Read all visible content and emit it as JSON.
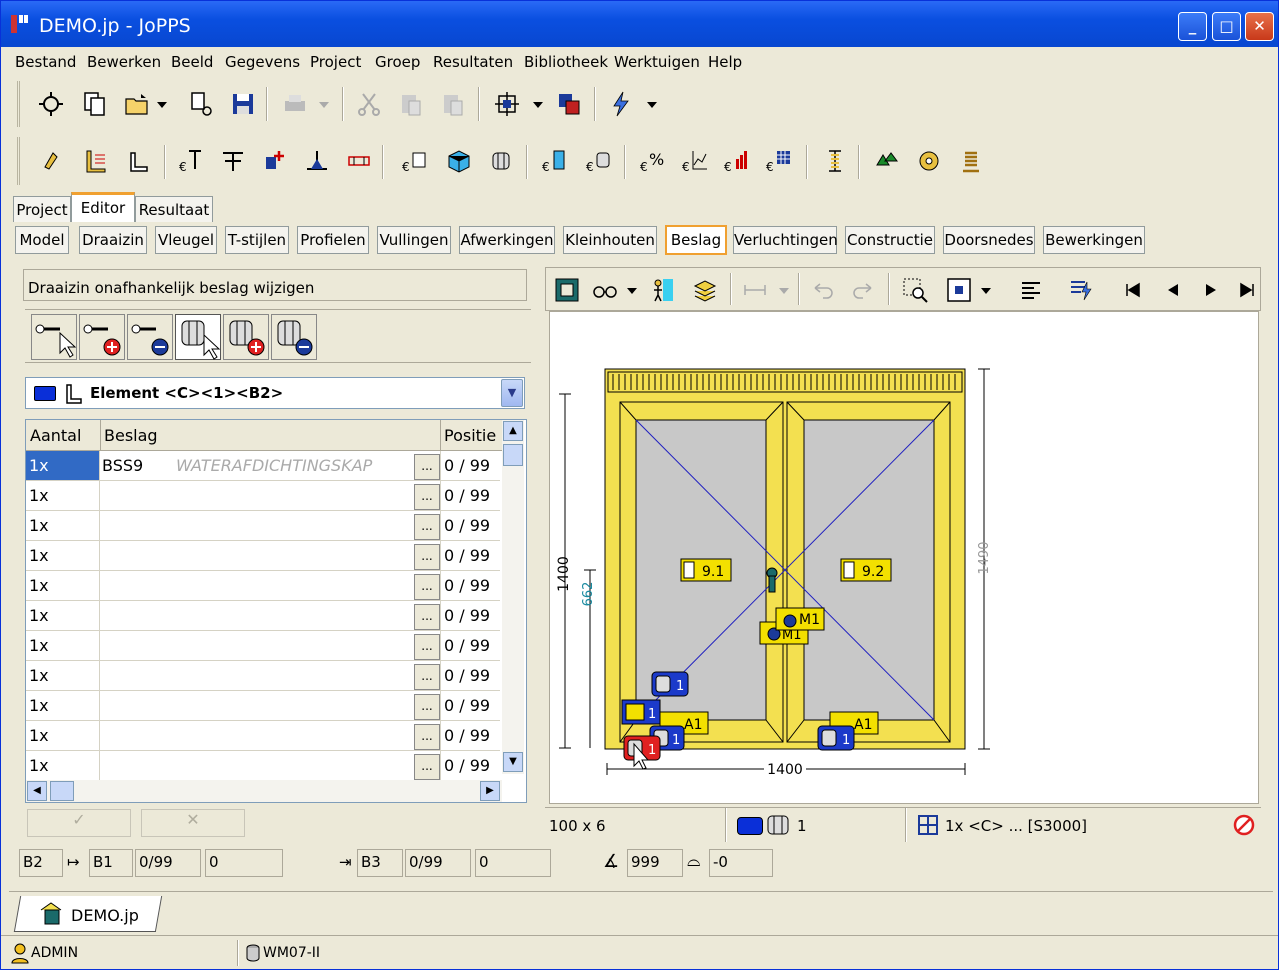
{
  "window": {
    "title": "DEMO.jp - JoPPS"
  },
  "menu": [
    "Bestand",
    "Bewerken",
    "Beeld",
    "Gegevens",
    "Project",
    "Groep",
    "Resultaten",
    "Bibliotheek",
    "Werktuigen",
    "Help"
  ],
  "main_tabs": [
    "Project",
    "Editor",
    "Resultaat"
  ],
  "editor_tabs": [
    "Model",
    "Draaizin",
    "Vleugel",
    "T-stijlen",
    "Profielen",
    "Vullingen",
    "Afwerkingen",
    "Kleinhouten",
    "Beslag",
    "Verluchtingen",
    "Constructie",
    "Doorsnedes",
    "Bewerkingen"
  ],
  "left_panel": {
    "header": "Draaizin onafhankelijk beslag wijzigen",
    "element_label": "Element <C><1><B2>",
    "columns": [
      "Aantal",
      "Beslag",
      "Positie"
    ],
    "rows": [
      {
        "aantal": "1x",
        "beslag": "BSS9",
        "desc": "WATERAFDICHTINGSKAP",
        "positie": "0 / 99"
      },
      {
        "aantal": "1x",
        "beslag": "",
        "desc": "",
        "positie": "0 / 99"
      },
      {
        "aantal": "1x",
        "beslag": "",
        "desc": "",
        "positie": "0 / 99"
      },
      {
        "aantal": "1x",
        "beslag": "",
        "desc": "",
        "positie": "0 / 99"
      },
      {
        "aantal": "1x",
        "beslag": "",
        "desc": "",
        "positie": "0 / 99"
      },
      {
        "aantal": "1x",
        "beslag": "",
        "desc": "",
        "positie": "0 / 99"
      },
      {
        "aantal": "1x",
        "beslag": "",
        "desc": "",
        "positie": "0 / 99"
      },
      {
        "aantal": "1x",
        "beslag": "",
        "desc": "",
        "positie": "0 / 99"
      },
      {
        "aantal": "1x",
        "beslag": "",
        "desc": "",
        "positie": "0 / 99"
      },
      {
        "aantal": "1x",
        "beslag": "",
        "desc": "",
        "positie": "0 / 99"
      },
      {
        "aantal": "1x",
        "beslag": "",
        "desc": "",
        "positie": "0 / 99"
      }
    ],
    "dots_label": "..."
  },
  "bottom_fields": {
    "f1": "B2",
    "f2": "B1",
    "f3": "0/99",
    "f4": "0",
    "f5": "B3",
    "f6": "0/99",
    "f7": "0",
    "angle": "999",
    "arc": "-0"
  },
  "drawing": {
    "width_label": "1400",
    "height_label": "1400",
    "height_total": "1490",
    "handle_height": "662",
    "labels": {
      "l91": "9.1",
      "l92": "9.2",
      "m1a": "M1",
      "m1b": "M1",
      "a1a": "A1",
      "a1b": "A1",
      "h1a": "1",
      "h1b": "1",
      "h1c": "1",
      "h1d": "1",
      "h1e": "1"
    }
  },
  "canvas_status": {
    "size": "100 x 6",
    "count": "1",
    "info": "1x <C> ... [S3000]"
  },
  "doc_tab": "DEMO.jp",
  "statusbar": {
    "user": "ADMIN",
    "station": "WM07-II"
  }
}
